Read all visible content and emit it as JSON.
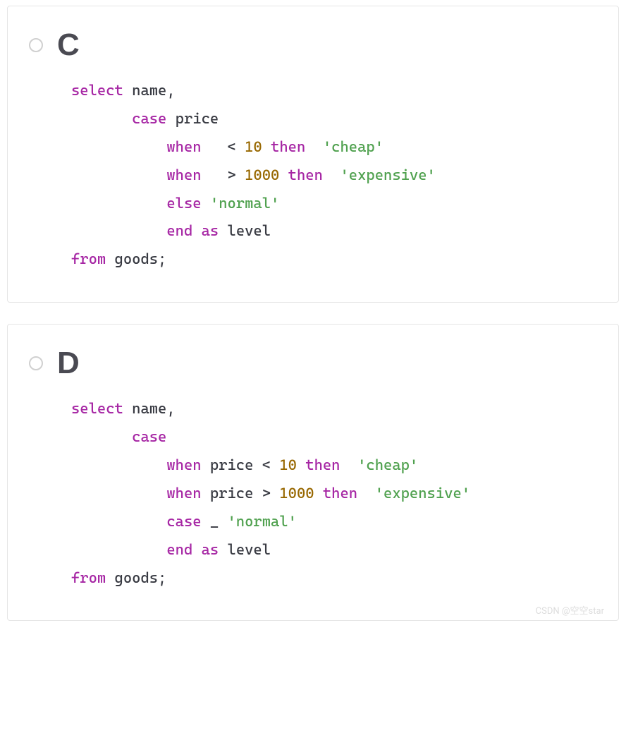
{
  "options": {
    "c": {
      "letter": "C",
      "code": {
        "l1_select": "select",
        "l1_name": " name",
        "l1_comma": ",",
        "l2_case": "case",
        "l2_price": " price",
        "l3_when": "when",
        "l3_op": "<",
        "l3_num": "10",
        "l3_then": "then",
        "l3_str": "'cheap'",
        "l4_when": "when",
        "l4_op": ">",
        "l4_num": "1000",
        "l4_then": "then",
        "l4_str": "'expensive'",
        "l5_else": "else",
        "l5_str": "'normal'",
        "l6_end": "end",
        "l6_as": "as",
        "l6_level": " level",
        "l7_from": "from",
        "l7_goods": " goods",
        "l7_semi": ";"
      }
    },
    "d": {
      "letter": "D",
      "code": {
        "l1_select": "select",
        "l1_name": " name",
        "l1_comma": ",",
        "l2_case": "case",
        "l3_when": "when",
        "l3_price": " price ",
        "l3_op": "<",
        "l3_num": "10",
        "l3_then": "then",
        "l3_str": "'cheap'",
        "l4_when": "when",
        "l4_price": " price ",
        "l4_op": ">",
        "l4_num": "1000",
        "l4_then": "then",
        "l4_str": "'expensive'",
        "l5_case": "case",
        "l5_under": " _ ",
        "l5_str": "'normal'",
        "l6_end": "end",
        "l6_as": "as",
        "l6_level": " level",
        "l7_from": "from",
        "l7_goods": " goods",
        "l7_semi": ";"
      }
    }
  },
  "watermark": "CSDN @空空star"
}
